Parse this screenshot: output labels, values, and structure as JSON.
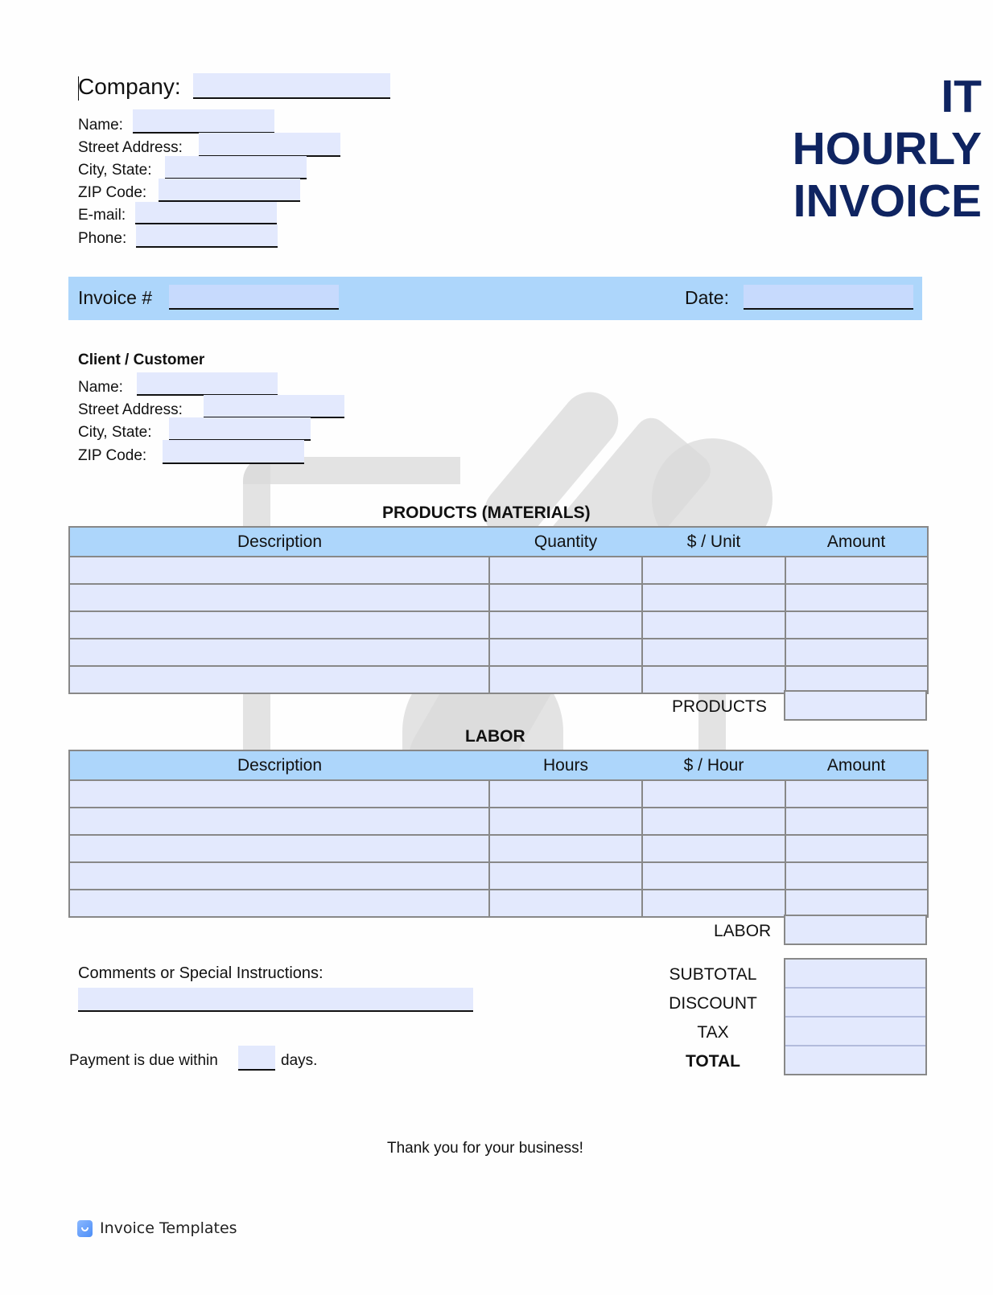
{
  "header": {
    "title_lines": [
      "IT",
      "HOURLY",
      "INVOICE"
    ],
    "company_label": "Company:",
    "company_value": "",
    "sender_fields": [
      {
        "label": "Name:",
        "value": ""
      },
      {
        "label": "Street Address:",
        "value": ""
      },
      {
        "label": "City, State:",
        "value": ""
      },
      {
        "label": "ZIP Code:",
        "value": ""
      },
      {
        "label": "E-mail:",
        "value": ""
      },
      {
        "label": "Phone:",
        "value": ""
      }
    ]
  },
  "banner": {
    "invoice_label": "Invoice #",
    "invoice_value": "",
    "date_label": "Date:",
    "date_value": ""
  },
  "client": {
    "heading": "Client / Customer",
    "fields": [
      {
        "label": "Name:",
        "value": ""
      },
      {
        "label": "Street Address:",
        "value": ""
      },
      {
        "label": "City, State:",
        "value": ""
      },
      {
        "label": "ZIP Code:",
        "value": ""
      }
    ]
  },
  "products": {
    "title": "PRODUCTS (MATERIALS)",
    "columns": [
      "Description",
      "Quantity",
      "$ / Unit",
      "Amount"
    ],
    "rows": [
      [
        "",
        "",
        "",
        ""
      ],
      [
        "",
        "",
        "",
        ""
      ],
      [
        "",
        "",
        "",
        ""
      ],
      [
        "",
        "",
        "",
        ""
      ],
      [
        "",
        "",
        "",
        ""
      ]
    ],
    "total_label": "PRODUCTS",
    "total_value": ""
  },
  "labor": {
    "title": "LABOR",
    "columns": [
      "Description",
      "Hours",
      "$ / Hour",
      "Amount"
    ],
    "rows": [
      [
        "",
        "",
        "",
        ""
      ],
      [
        "",
        "",
        "",
        ""
      ],
      [
        "",
        "",
        "",
        ""
      ],
      [
        "",
        "",
        "",
        ""
      ],
      [
        "",
        "",
        "",
        ""
      ]
    ],
    "total_label": "LABOR",
    "total_value": ""
  },
  "comments": {
    "label": "Comments or Special Instructions:",
    "value": ""
  },
  "payment": {
    "prefix": "Payment is due within",
    "days_value": "",
    "suffix": "days."
  },
  "totals": [
    {
      "label": "SUBTOTAL",
      "value": "",
      "bold": false
    },
    {
      "label": "DISCOUNT",
      "value": "",
      "bold": false
    },
    {
      "label": "TAX",
      "value": "",
      "bold": false
    },
    {
      "label": "TOTAL",
      "value": "",
      "bold": true
    }
  ],
  "footer": {
    "thanks": "Thank you for your business!",
    "brand": "Invoice Templates"
  },
  "colors": {
    "title": "#0f2461",
    "banner": "#add6fb",
    "field": "#e3e9fd",
    "header_row": "#add6fb"
  }
}
